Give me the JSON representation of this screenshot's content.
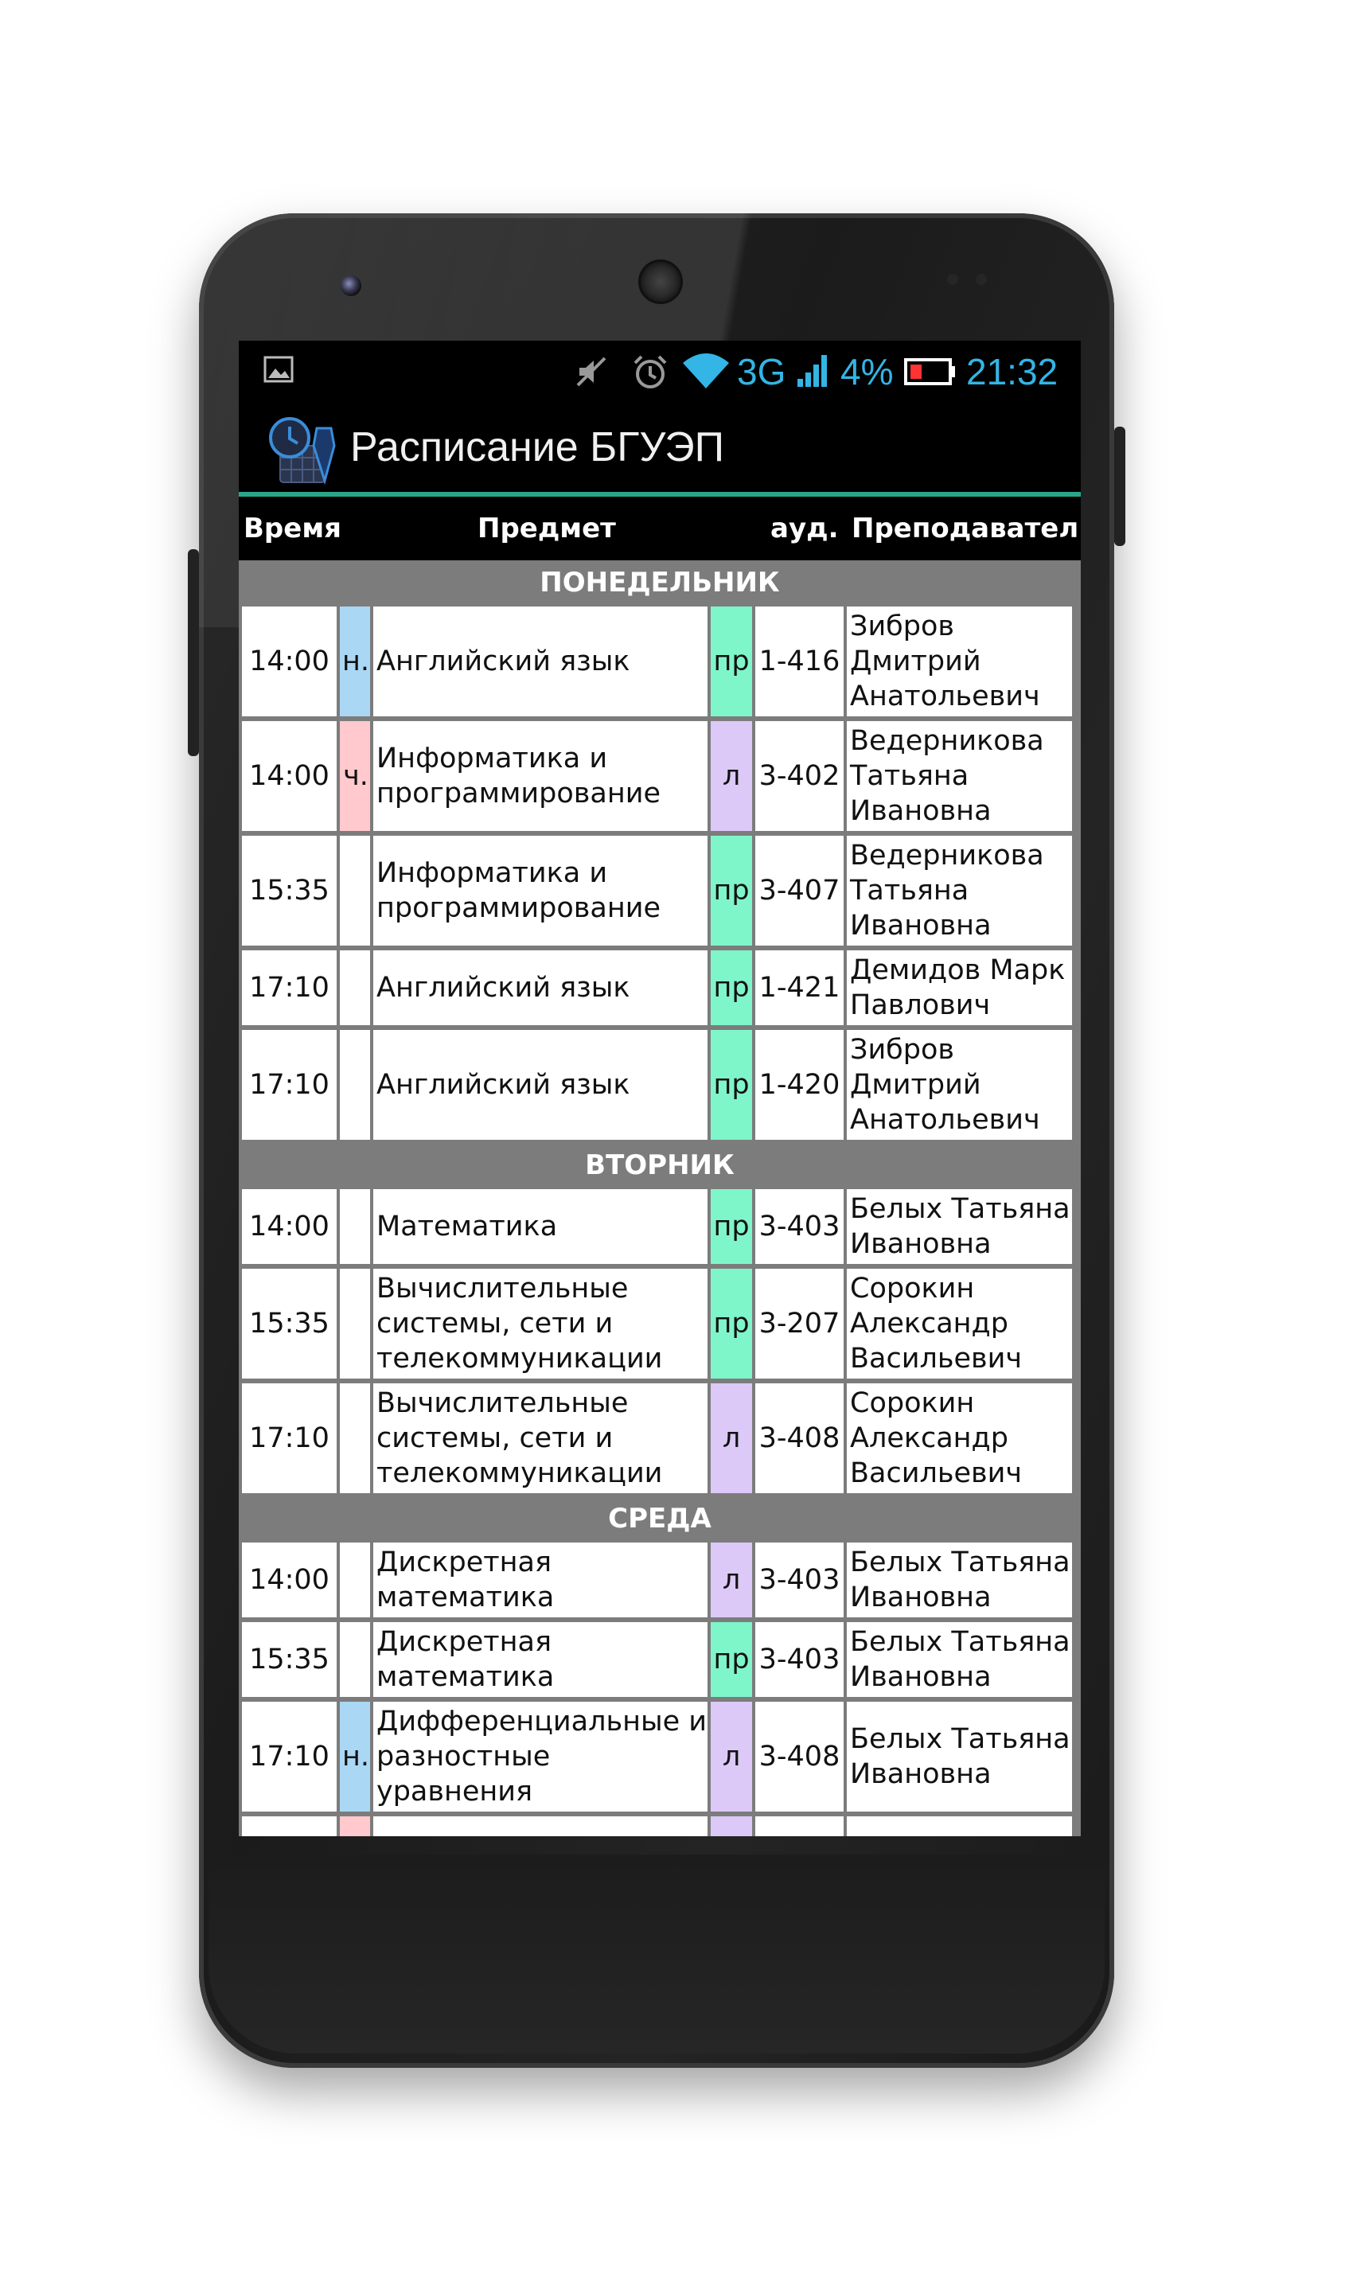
{
  "status_bar": {
    "network": "3G",
    "battery_percent": "4%",
    "time": "21:32"
  },
  "action_bar": {
    "title": "Расписание БГУЭП"
  },
  "columns": {
    "time": "Время",
    "subject": "Предмет",
    "room": "ауд.",
    "teacher": "Преподаватель"
  },
  "days": [
    {
      "name": "ПОНЕДЕЛЬНИК",
      "rows": [
        {
          "time": "14:00",
          "week": "н.",
          "subject": "Английский язык",
          "type": "пр",
          "room": "1-416",
          "teacher": "Зибров Дмитрий Анатольевич"
        },
        {
          "time": "14:00",
          "week": "ч.",
          "subject": "Информатика и программирование",
          "type": "л",
          "room": "3-402",
          "teacher": "Ведерникова Татьяна Ивановна"
        },
        {
          "time": "15:35",
          "week": "",
          "subject": "Информатика и программирование",
          "type": "пр",
          "room": "3-407",
          "teacher": "Ведерникова Татьяна Ивановна"
        },
        {
          "time": "17:10",
          "week": "",
          "subject": "Английский язык",
          "type": "пр",
          "room": "1-421",
          "teacher": "Демидов Марк Павлович"
        },
        {
          "time": "17:10",
          "week": "",
          "subject": "Английский язык",
          "type": "пр",
          "room": "1-420",
          "teacher": "Зибров Дмитрий Анатольевич"
        }
      ]
    },
    {
      "name": "ВТОРНИК",
      "rows": [
        {
          "time": "14:00",
          "week": "",
          "subject": "Математика",
          "type": "пр",
          "room": "3-403",
          "teacher": "Белых Татьяна Ивановна"
        },
        {
          "time": "15:35",
          "week": "",
          "subject": "Вычислительные системы, сети и телекоммуникации",
          "type": "пр",
          "room": "3-207",
          "teacher": "Сорокин Александр Васильевич"
        },
        {
          "time": "17:10",
          "week": "",
          "subject": "Вычислительные системы, сети и телекоммуникации",
          "type": "л",
          "room": "3-408",
          "teacher": "Сорокин Александр Васильевич"
        }
      ]
    },
    {
      "name": "СРЕДА",
      "rows": [
        {
          "time": "14:00",
          "week": "",
          "subject": "Дискретная математика",
          "type": "л",
          "room": "3-403",
          "teacher": "Белых Татьяна Ивановна"
        },
        {
          "time": "15:35",
          "week": "",
          "subject": "Дискретная математика",
          "type": "пр",
          "room": "3-403",
          "teacher": "Белых Татьяна Ивановна"
        },
        {
          "time": "17:10",
          "week": "н.",
          "subject": "Дифференциальные и разностные уравнения",
          "type": "л",
          "room": "3-408",
          "teacher": "Белых Татьяна Ивановна"
        }
      ]
    }
  ],
  "colors": {
    "accent": "#2aa58a",
    "status_text": "#33b5e5",
    "week_odd": "#aad7f4",
    "week_even": "#ffc9cd",
    "type_practice": "#7ff5ca",
    "type_lecture": "#dcc9f7",
    "day_header": "#7c7c7c"
  }
}
